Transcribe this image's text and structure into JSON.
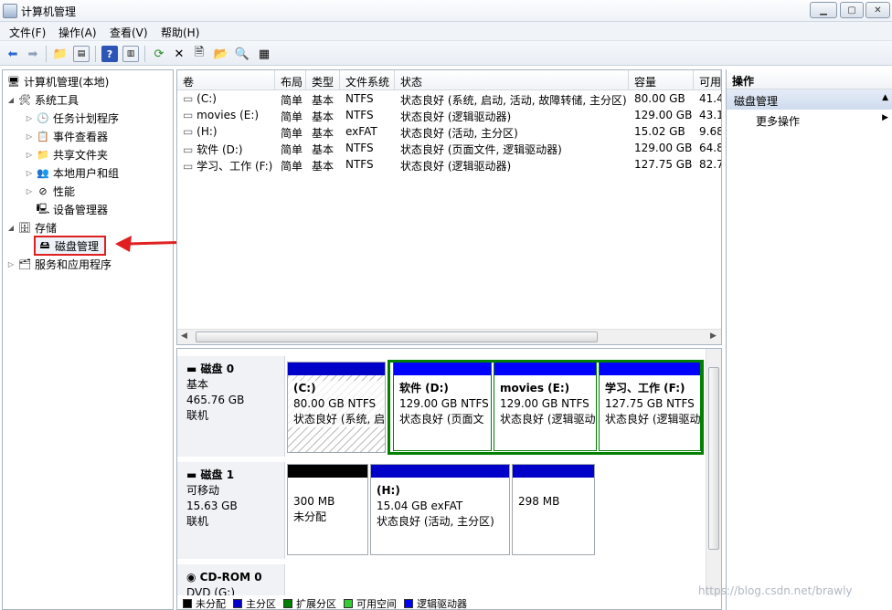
{
  "window": {
    "title": "计算机管理"
  },
  "menu": [
    "文件(F)",
    "操作(A)",
    "查看(V)",
    "帮助(H)"
  ],
  "tree": {
    "root": "计算机管理(本地)",
    "system_tools": "系统工具",
    "task_scheduler": "任务计划程序",
    "event_viewer": "事件查看器",
    "shared_folders": "共享文件夹",
    "local_users": "本地用户和组",
    "performance": "性能",
    "device_manager": "设备管理器",
    "storage": "存储",
    "disk_management": "磁盘管理",
    "services": "服务和应用程序"
  },
  "volume_table": {
    "columns": [
      "卷",
      "布局",
      "类型",
      "文件系统",
      "状态",
      "容量",
      "可用"
    ],
    "rows": [
      {
        "vol": "(C:)",
        "layout": "简单",
        "type": "基本",
        "fs": "NTFS",
        "status": "状态良好 (系统, 启动, 活动, 故障转储, 主分区)",
        "cap": "80.00 GB",
        "free": "41.4"
      },
      {
        "vol": "movies (E:)",
        "layout": "简单",
        "type": "基本",
        "fs": "NTFS",
        "status": "状态良好 (逻辑驱动器)",
        "cap": "129.00 GB",
        "free": "43.1"
      },
      {
        "vol": "(H:)",
        "layout": "简单",
        "type": "基本",
        "fs": "exFAT",
        "status": "状态良好 (活动, 主分区)",
        "cap": "15.02 GB",
        "free": "9.68"
      },
      {
        "vol": "软件 (D:)",
        "layout": "简单",
        "type": "基本",
        "fs": "NTFS",
        "status": "状态良好 (页面文件, 逻辑驱动器)",
        "cap": "129.00 GB",
        "free": "64.8"
      },
      {
        "vol": "学习、工作 (F:)",
        "layout": "简单",
        "type": "基本",
        "fs": "NTFS",
        "status": "状态良好 (逻辑驱动器)",
        "cap": "127.75 GB",
        "free": "82.7"
      }
    ]
  },
  "disks": {
    "disk0": {
      "name": "磁盘 0",
      "type": "基本",
      "size": "465.76 GB",
      "state": "联机",
      "parts": [
        {
          "title": "(C:)",
          "size": "80.00 GB NTFS",
          "status": "状态良好 (系统, 启"
        },
        {
          "title": "软件  (D:)",
          "size": "129.00 GB NTFS",
          "status": "状态良好 (页面文"
        },
        {
          "title": "movies  (E:)",
          "size": "129.00 GB NTFS",
          "status": "状态良好 (逻辑驱动"
        },
        {
          "title": "学习、工作  (F:)",
          "size": "127.75 GB NTFS",
          "status": "状态良好 (逻辑驱动"
        }
      ]
    },
    "disk1": {
      "name": "磁盘 1",
      "type": "可移动",
      "size": "15.63 GB",
      "state": "联机",
      "parts": [
        {
          "size": "300 MB",
          "status": "未分配"
        },
        {
          "title": "(H:)",
          "size": "15.04 GB exFAT",
          "status": "状态良好 (活动, 主分区)"
        },
        {
          "size": "298 MB"
        }
      ]
    },
    "cdrom": {
      "name": "CD-ROM 0",
      "type": "DVD (G:)"
    }
  },
  "legend": [
    "未分配",
    "主分区",
    "扩展分区",
    "可用空间",
    "逻辑驱动器"
  ],
  "actions": {
    "header": "操作",
    "section": "磁盘管理",
    "more": "更多操作"
  },
  "watermark": "https://blog.csdn.net/brawly",
  "colors": {
    "primary": "#0000c8",
    "extended": "#008000",
    "free": "#33cc33",
    "logical": "#0000ff",
    "unallocated": "#000000",
    "highlight": "#e02020"
  }
}
